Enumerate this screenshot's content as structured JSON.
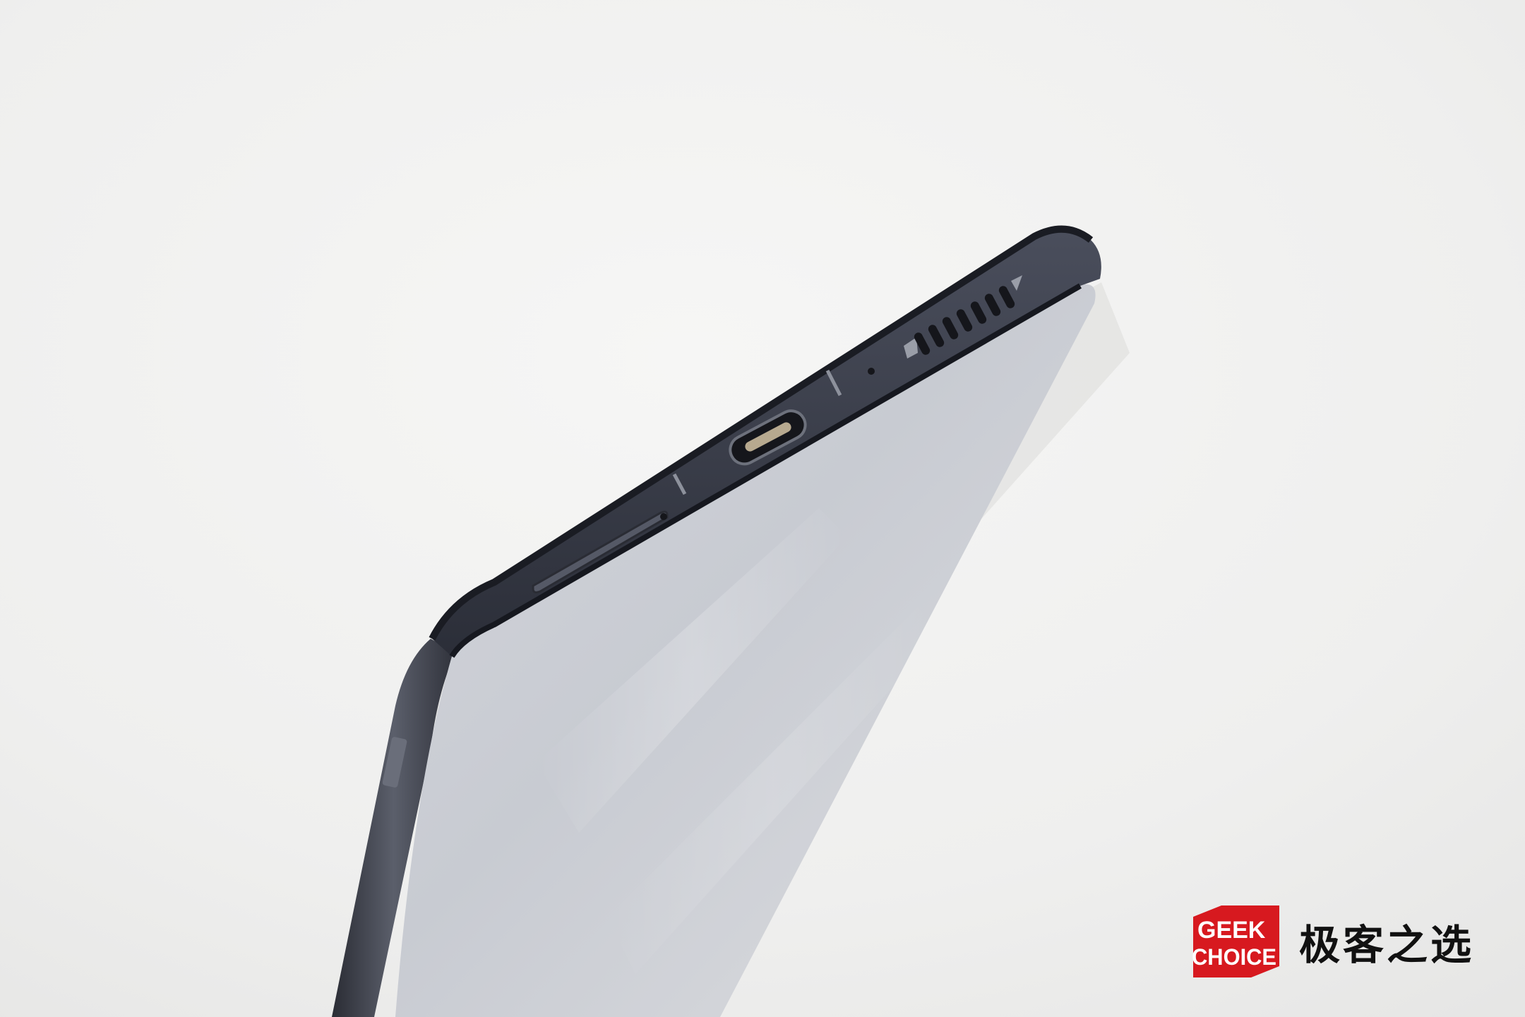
{
  "photo": {
    "subject": "phone-bottom-edge",
    "ports": [
      "sim-tray",
      "usb-c-port",
      "microphone-hole",
      "speaker-grille"
    ],
    "speaker_slot_count": 7
  },
  "watermark": {
    "logo_line1": "GEEK",
    "logo_line2": "CHOICE",
    "brand_text": "极客之选",
    "logo_color": "#d7191f",
    "logo_text_color": "#ffffff"
  },
  "colors": {
    "background": "#efefee",
    "phone_frame": "#3a3d48",
    "phone_edge": "#1d1f27",
    "screen_glass": "#c9ccd2"
  }
}
